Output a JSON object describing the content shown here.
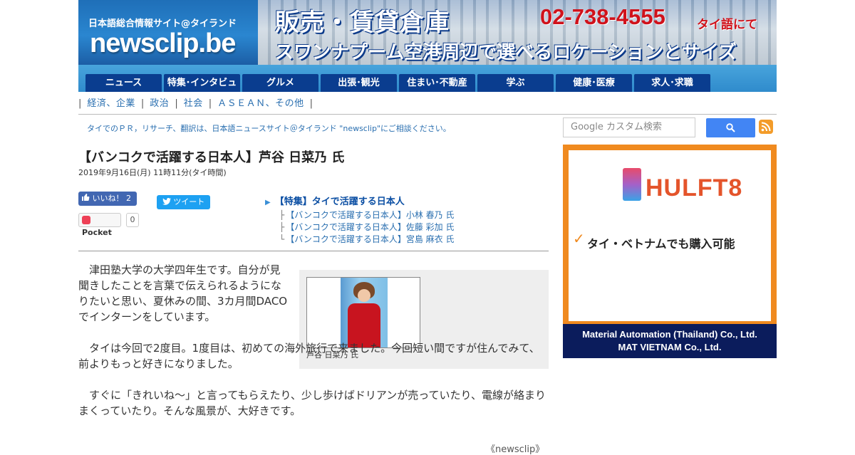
{
  "header": {
    "logo_sub": "日本語総合情報サイト@タイランド",
    "logo_main": "newsclip.be",
    "banner": {
      "line1": "販売・賃貸倉庫",
      "phone": "02-738-4555",
      "phone_note": "タイ語にて",
      "line2": "スワンナプーム空港周辺で選べるロケーションとサイズ"
    }
  },
  "nav": {
    "items": [
      "ニュース",
      "特集･インタビュー",
      "グルメ",
      "出張･観光",
      "住まい･不動産",
      "学ぶ",
      "健康･医療",
      "求人･求職"
    ]
  },
  "subnav": {
    "items": [
      "経済、企業",
      "政治",
      "社会",
      "ＡＳＥＡＮ、その他"
    ]
  },
  "promo": "タイでのＰＲ，リサーチ、翻訳は、日本語ニュースサイト＠タイランド \"newsclip\"にご相談ください。",
  "article": {
    "title": "【バンコクで活躍する日本人】芦谷 日菜乃 氏",
    "date": "2019年9月16日(月) 11時11分(タイ時間)",
    "paragraphs": [
      "　津田塾大学の大学四年生です。自分が見聞きしたことを言葉で伝えられるようになりたいと思い、夏休みの間、3カ月間DACOでインターンをしています。",
      "　タイは今回で2度目。1度目は、初めての海外旅行で来ました。今回短い間ですが住んでみて、前よりもっと好きになりました。",
      "　すぐに「きれいね～」と言ってもらえたり、少し歩けばドリアンが売っていたり、電線が絡まりまくっていたり。そんな風景が、大好きです。"
    ],
    "photo_caption": "芦谷 日菜乃 氏",
    "credit": "《newsclip》"
  },
  "social": {
    "like_label": "いいね！",
    "like_count": "2",
    "tweet_label": "ツイート",
    "pocket_label": "Pocket",
    "pocket_count": "0"
  },
  "special": {
    "heading": "【特集】タイで活躍する日本人",
    "items": [
      "【バンコクで活躍する日本人】小林 春乃 氏",
      "【バンコクで活躍する日本人】佐藤 彩加 氏",
      "【バンコクで活躍する日本人】宮島 麻衣 氏"
    ]
  },
  "sidebar": {
    "search_placeholder": "Google カスタム検索",
    "ad": {
      "brand": "HULFT8",
      "tagline": "タイ・ベトナムでも購入可能",
      "company1": "Material Automation (Thailand) Co., Ltd.",
      "company2": "MAT VIETNAM Co., Ltd."
    }
  },
  "colors": {
    "nav_bg": "#2f8bcc",
    "nav_item": "#0a3d8f",
    "link": "#2a6fb0",
    "ad_border": "#f08a1f",
    "ad_footer": "#0b1c5c"
  }
}
